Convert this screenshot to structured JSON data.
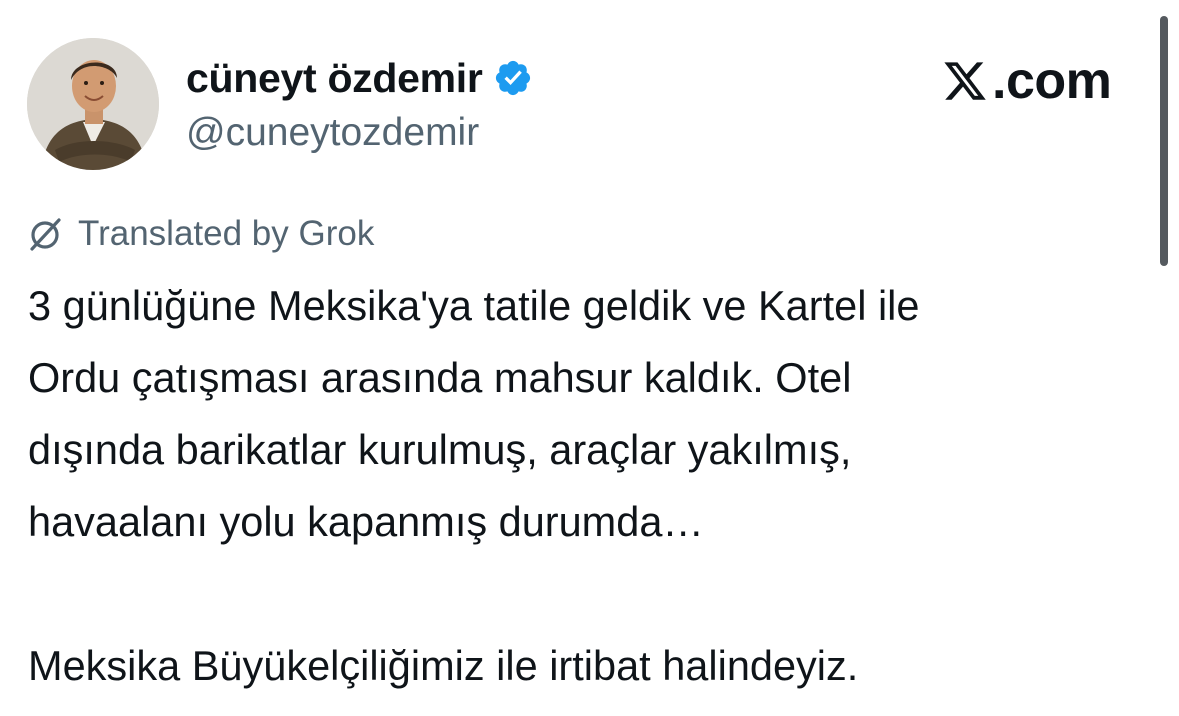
{
  "author": {
    "display_name": "cüneyt özdemir",
    "handle": "@cuneytozdemir",
    "verified": true,
    "verified_color": "#1d9bf0"
  },
  "brand": {
    "text": ".com",
    "icon": "x-logo-icon"
  },
  "translation": {
    "label": "Translated by Grok",
    "icon": "grok-icon"
  },
  "tweet": {
    "lines": [
      "3 günlüğüne Meksika'ya tatile geldik ve Kartel ile",
      "Ordu çatışması arasında mahsur kaldık. Otel",
      "dışında barikatlar kurulmuş, araçlar yakılmış,",
      "havaalanı yolu kapanmış durumda…"
    ],
    "last_paragraph": "Meksika Büyükelçiliğimiz ile irtibat halindeyiz."
  },
  "colors": {
    "text_primary": "#0f1419",
    "text_secondary": "#536471",
    "scrollbar": "#555a5f"
  }
}
